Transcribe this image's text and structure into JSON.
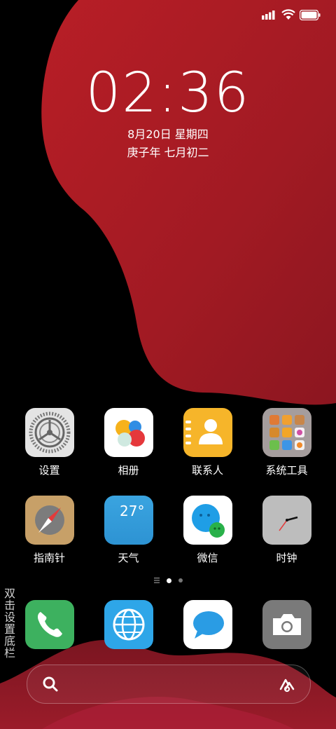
{
  "status_bar": {
    "signal_icon": "signal-bars-icon",
    "wifi_icon": "wifi-icon",
    "battery_icon": "battery-icon"
  },
  "clock": {
    "time": "02:36",
    "date": "8月20日 星期四",
    "lunar": "庚子年 七月初二"
  },
  "apps_row1": [
    {
      "label": "设置",
      "icon": "settings-gear-icon"
    },
    {
      "label": "相册",
      "icon": "gallery-icon"
    },
    {
      "label": "联系人",
      "icon": "contacts-icon"
    },
    {
      "label": "系统工具",
      "icon": "folder-icon"
    }
  ],
  "apps_row2": [
    {
      "label": "指南针",
      "icon": "compass-icon"
    },
    {
      "label": "天气",
      "icon": "weather-icon",
      "temp": "27°"
    },
    {
      "label": "微信",
      "icon": "wechat-icon"
    },
    {
      "label": "时钟",
      "icon": "clock-icon"
    }
  ],
  "dock": [
    {
      "icon": "phone-icon"
    },
    {
      "icon": "browser-icon"
    },
    {
      "icon": "messages-icon"
    },
    {
      "icon": "camera-icon"
    }
  ],
  "page_indicator": {
    "pages": 2,
    "current": 1
  },
  "side_hint": "双击设置底栏",
  "search_bar": {
    "search_icon": "search-icon",
    "assistant_icon": "assistant-icon"
  },
  "colors": {
    "wallpaper_red": "#a51c24",
    "wallpaper_dark_red": "#7b1520"
  }
}
